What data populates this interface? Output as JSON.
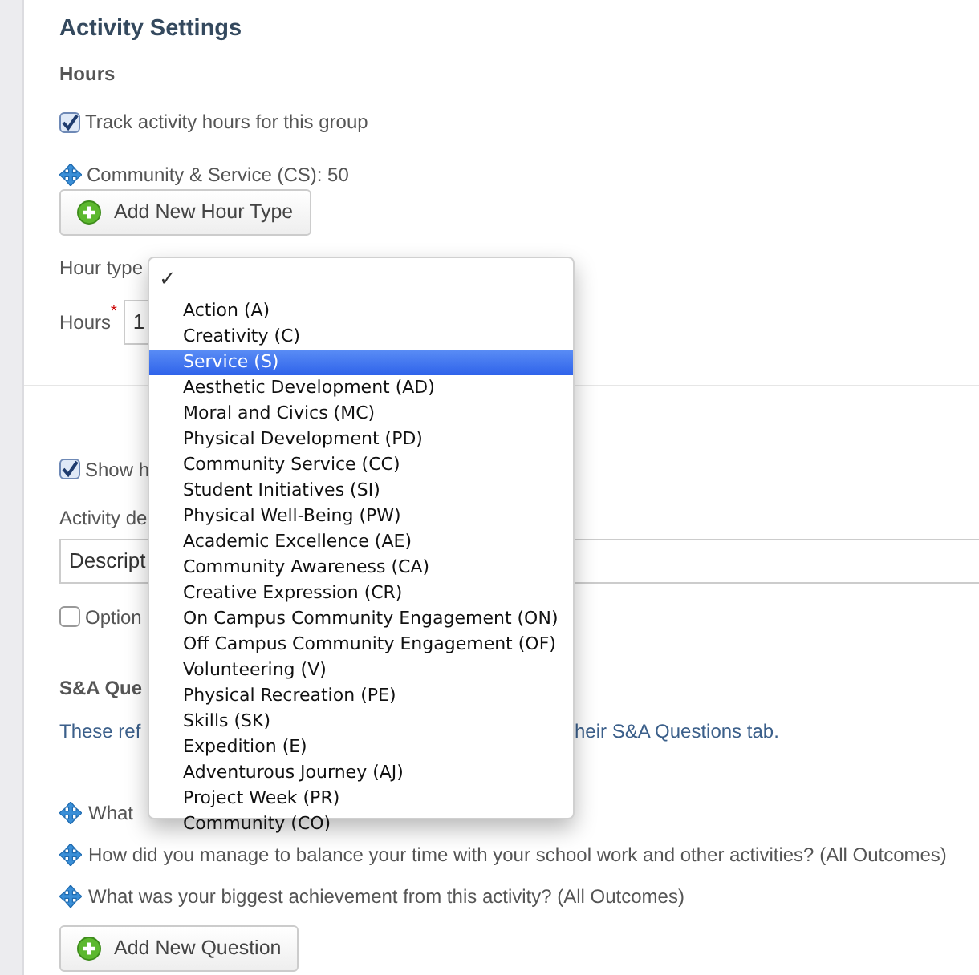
{
  "title": "Activity Settings",
  "hours": {
    "heading": "Hours",
    "track_checkbox": {
      "label": "Track activity hours for this group",
      "checked": true
    },
    "hour_types": [
      "Community & Service (CS): 50"
    ],
    "add_button": "Add New Hour Type",
    "hour_type_label": "Hour type",
    "hours_label": "Hours",
    "hours_required": "*",
    "hours_value": "1"
  },
  "display": {
    "show_checkbox": {
      "label": "Show h",
      "checked": true
    },
    "description_label": "Activity de",
    "description_value": "Descript",
    "optional_checkbox": {
      "label": "Option",
      "checked": false
    }
  },
  "questions": {
    "heading": "S&A Que",
    "note_start": "These ref",
    "note_end": "heir S&A Questions tab.",
    "items": [
      "What",
      "How did you manage to balance your time with your school work and other activities? (All Outcomes)",
      "What was your biggest achievement from this activity? (All Outcomes)"
    ],
    "add_button": "Add New Question"
  },
  "dropdown": {
    "check_mark": "✓",
    "options": [
      {
        "label": "Action (A)",
        "selected": false
      },
      {
        "label": "Creativity (C)",
        "selected": false
      },
      {
        "label": "Service (S)",
        "selected": true
      },
      {
        "label": "Aesthetic Development (AD)",
        "selected": false
      },
      {
        "label": "Moral and Civics (MC)",
        "selected": false
      },
      {
        "label": "Physical Development (PD)",
        "selected": false
      },
      {
        "label": "Community Service (CC)",
        "selected": false
      },
      {
        "label": "Student Initiatives (SI)",
        "selected": false
      },
      {
        "label": "Physical Well-Being (PW)",
        "selected": false
      },
      {
        "label": "Academic Excellence (AE)",
        "selected": false
      },
      {
        "label": "Community Awareness (CA)",
        "selected": false
      },
      {
        "label": "Creative Expression (CR)",
        "selected": false
      },
      {
        "label": "On Campus Community Engagement (ON)",
        "selected": false
      },
      {
        "label": "Off Campus Community Engagement (OF)",
        "selected": false
      },
      {
        "label": "Volunteering (V)",
        "selected": false
      },
      {
        "label": "Physical Recreation (PE)",
        "selected": false
      },
      {
        "label": "Skills (SK)",
        "selected": false
      },
      {
        "label": "Expedition (E)",
        "selected": false
      },
      {
        "label": "Adventurous Journey (AJ)",
        "selected": false
      },
      {
        "label": "Project Week (PR)",
        "selected": false
      },
      {
        "label": "Community (CO)",
        "selected": false
      }
    ]
  }
}
